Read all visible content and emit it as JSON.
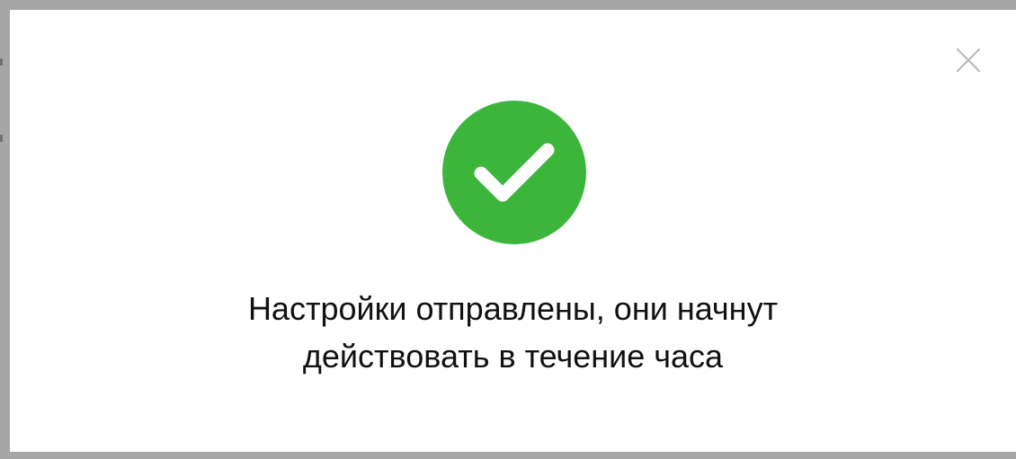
{
  "dialog": {
    "close_icon": "close-icon",
    "status_icon": "success-check-icon",
    "status_color": "#3bb63b",
    "message_lines": [
      "Настройки отправлены, они начнут",
      "действовать в течение часа"
    ]
  },
  "colors": {
    "overlay": "#a6a6a6",
    "modal_background": "#ffffff",
    "text": "#111111",
    "close_icon": "#b8b8b8",
    "success": "#3bb63b"
  }
}
